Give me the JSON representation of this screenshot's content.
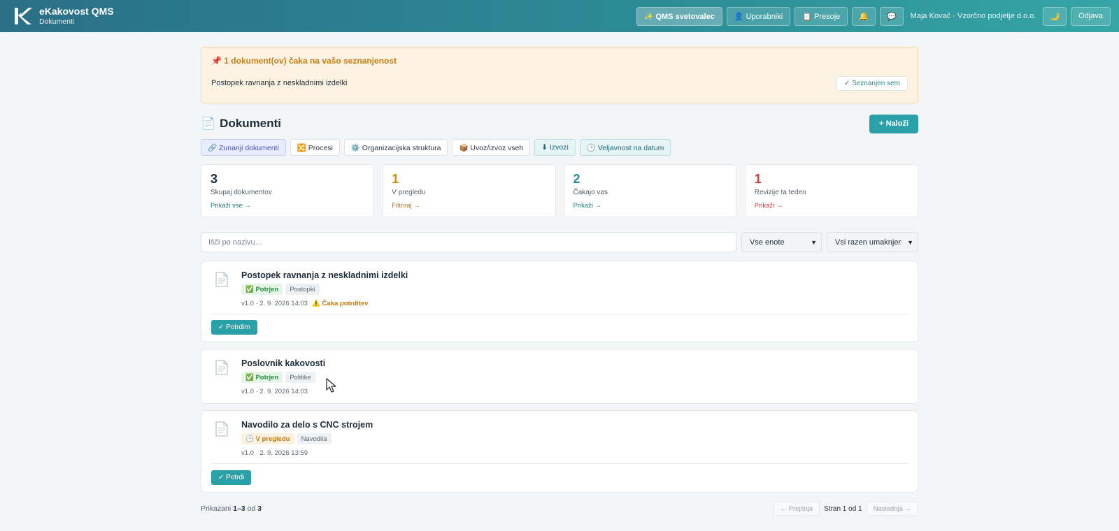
{
  "header": {
    "app_title": "eKakovost QMS",
    "page_subtitle": "Dokumenti",
    "buttons": {
      "advisor": "✨ QMS svetovalec",
      "users": "👤 Uporabniki",
      "audits": "📋 Presoje",
      "notifications_icon": "🔔",
      "chat_icon": "💬",
      "theme_icon": "🌙",
      "logout": "Odjava"
    },
    "user_info": "Maja Kovač · Vzorčno podjetje d.o.o."
  },
  "notice": {
    "title": "📌 1 dokument(ov) čaka na vašo seznanjenost",
    "document": "Postopek ravnanja z neskladnimi izdelki",
    "ack_label": "✓ Seznanjen sem"
  },
  "page": {
    "title_icon": "📄",
    "title": "Dokumenti",
    "upload_label": "+ Naloži"
  },
  "subnav": [
    {
      "label": "🔗 Zunanji dokumenti"
    },
    {
      "label": "🔀 Procesi"
    },
    {
      "label": "⚙️ Organizacijska struktura"
    },
    {
      "label": "📦 Uvoz/izvoz vseh"
    },
    {
      "label": "⬇ Izvozi"
    },
    {
      "label": "🕒 Veljavnost na datum"
    }
  ],
  "stats": [
    {
      "value": "3",
      "label": "Skupaj dokumentov",
      "link": "Prikaži vse →",
      "color": "#1f2d3a",
      "link_color": "#2c7a86"
    },
    {
      "value": "1",
      "label": "V pregledu",
      "link": "Filtriraj →",
      "color": "#d08a12",
      "link_color": "#c07a10"
    },
    {
      "value": "2",
      "label": "Čakajo vas",
      "link": "Prikaži →",
      "color": "#2c8a95",
      "link_color": "#2c7a86"
    },
    {
      "value": "1",
      "label": "Revizije ta teden",
      "link": "Prikaži →",
      "color": "#d13a3a",
      "link_color": "#d13a3a"
    }
  ],
  "filters": {
    "search_placeholder": "Išči po nazivu…",
    "unit_select": "Vse enote",
    "archive_select": "Vsi razen umaknjenih"
  },
  "documents": [
    {
      "title": "Postopek ravnanja z neskladnimi izdelki",
      "status": "✅ Potrjen",
      "category": "Postopki",
      "meta": "v1.0 · 2. 9. 2026 14:03",
      "warning": "⚠️ Čaka potrditev",
      "action": "✓ Potrdim"
    },
    {
      "title": "Poslovnik kakovosti",
      "status": "✅ Potrjen",
      "category": "Politike",
      "meta": "v1.0 · 2. 9. 2026 14:03",
      "warning": "",
      "action": ""
    },
    {
      "title": "Navodilo za delo s CNC strojem",
      "status": "🕒 V pregledu",
      "category": "Navodila",
      "meta": "v1.0 · 2. 9. 2026 13:59",
      "warning": "",
      "action": "✓ Potrdi"
    }
  ],
  "pagination": {
    "shown_prefix": "Prikazani",
    "shown_range": "1–3",
    "shown_of": "od",
    "total": "3",
    "prev": "← Prejšnja",
    "info": "Stran 1 od 1",
    "next": "Naslednja →"
  }
}
